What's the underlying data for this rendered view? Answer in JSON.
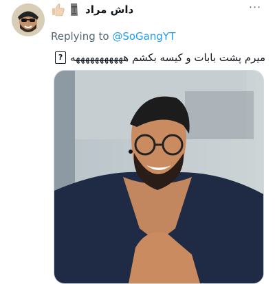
{
  "tweet": {
    "display_name": "داش مراد",
    "name_emojis": [
      "thumbs-up-icon",
      "moai-icon"
    ],
    "more_icon": "more-horizontal-icon",
    "reply_prefix": "Replying to",
    "reply_handle": "@SoGangYT",
    "text": "میرم پشت بابات و کیسه بکشم هههههههههههه",
    "trailing_glyph": "?"
  },
  "colors": {
    "link": "#1d9bf0",
    "secondary_text": "#536471",
    "primary_text": "#0f1419",
    "background": "#ffffff"
  }
}
